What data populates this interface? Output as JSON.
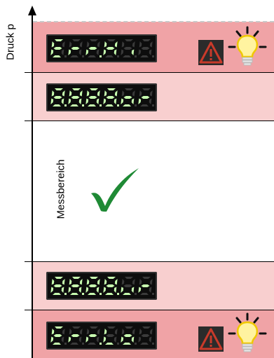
{
  "axis_label": "Druck p",
  "range_label": "Messbereich",
  "colors": {
    "zone_error": "#f0a3a6",
    "zone_over": "#f8cfcf",
    "segment_on": "#c8ffb0",
    "segment_off": "#3a3a3a",
    "display_bg": "#0d0d0d",
    "check": "#1f8a35",
    "warning_triangle": "#c93a2a",
    "bulb": "#fff3a0"
  },
  "displays": [
    {
      "text": "Err.Hi",
      "zone": "error-high"
    },
    {
      "text": "8.8.8.8.or",
      "zone": "over-range"
    },
    {
      "text": "8.8.8.8.ur",
      "zone": "under-range"
    },
    {
      "text": "Err.Lo",
      "zone": "error-low"
    }
  ],
  "icons": [
    "warning-triangle-icon",
    "light-bulb-icon",
    "checkmark-icon"
  ]
}
